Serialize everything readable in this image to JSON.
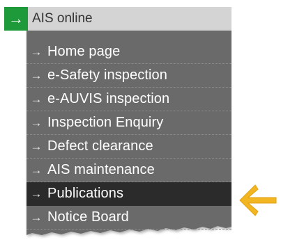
{
  "header": {
    "title": "AIS online",
    "arrow_glyph": "→"
  },
  "menu": {
    "item_arrow_glyph": "→",
    "items": [
      {
        "label": "Home page"
      },
      {
        "label": "e-Safety inspection"
      },
      {
        "label": "e-AUVIS inspection"
      },
      {
        "label": "Inspection Enquiry"
      },
      {
        "label": "Defect clearance"
      },
      {
        "label": "AIS maintenance"
      },
      {
        "label": "Publications",
        "active": true
      },
      {
        "label": "Notice Board"
      }
    ]
  },
  "colors": {
    "header_bg": "#d4d4d4",
    "header_arrow_bg": "#1f9a3a",
    "menu_bg": "#6b6b6b",
    "active_bg": "#2b2b2b",
    "callout_arrow": "#f2b623"
  },
  "icons": {
    "header_arrow": "right-arrow-icon",
    "item_arrow": "right-arrow-icon",
    "callout": "left-arrow-callout-icon"
  }
}
